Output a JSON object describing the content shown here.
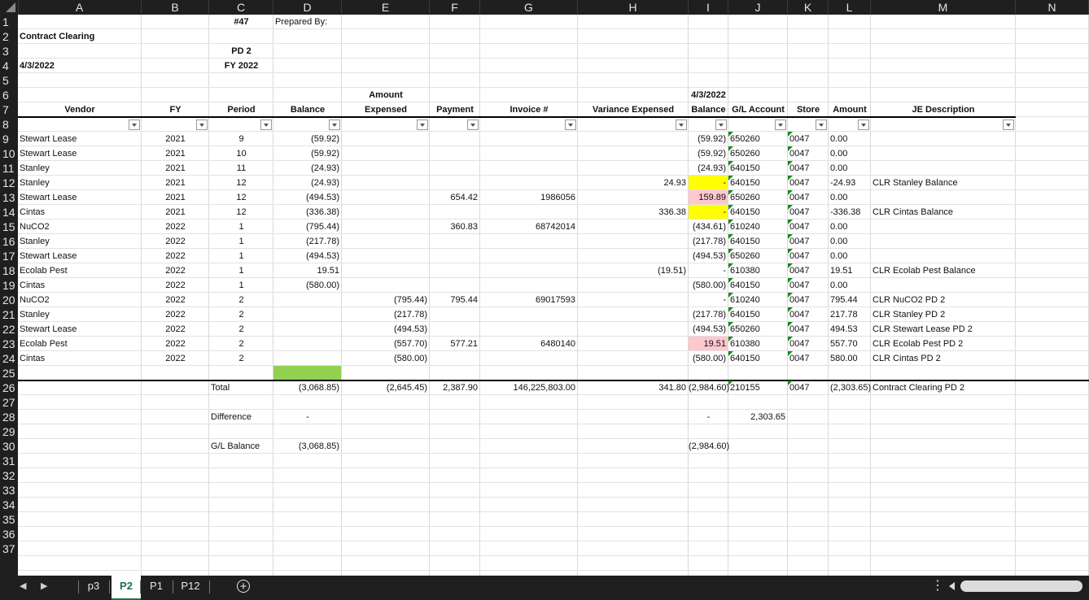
{
  "columns": [
    "A",
    "B",
    "C",
    "D",
    "E",
    "F",
    "G",
    "H",
    "I",
    "J",
    "K",
    "L",
    "M",
    "N"
  ],
  "rows": [
    "1",
    "2",
    "3",
    "4",
    "5",
    "6",
    "7",
    "8",
    "9",
    "10",
    "11",
    "12",
    "13",
    "14",
    "15",
    "16",
    "17",
    "18",
    "19",
    "20",
    "21",
    "22",
    "23",
    "24",
    "25",
    "26",
    "27",
    "28",
    "29",
    "30",
    "31",
    "32",
    "33",
    "34",
    "35",
    "36",
    "37"
  ],
  "header": {
    "sheet_no": "#47",
    "prepared_by": "Prepared By:",
    "title": "Contract Clearing",
    "period": "PD 2",
    "date": "4/3/2022",
    "fiscal_year": "FY 2022",
    "amount_label": "Amount",
    "balance_date": "4/3/2022"
  },
  "col_headers": {
    "vendor": "Vendor",
    "fy": "FY",
    "period": "Period",
    "balance": "Balance",
    "expensed": "Expensed",
    "payment": "Payment",
    "invoice": "Invoice #",
    "variance": "Variance Expensed",
    "balance2": "Balance",
    "gl": "G/L Account",
    "store": "Store",
    "amount": "Amount",
    "je": "JE Description"
  },
  "records": [
    {
      "vendor": "Stewart Lease",
      "fy": "2021",
      "period": "9",
      "balance": "(59.92)",
      "expensed": "",
      "payment": "",
      "invoice": "",
      "variance": "",
      "balance2": "(59.92)",
      "gl": "650260",
      "store": "0047",
      "amount": "0.00",
      "je": ""
    },
    {
      "vendor": "Stewart Lease",
      "fy": "2021",
      "period": "10",
      "balance": "(59.92)",
      "expensed": "",
      "payment": "",
      "invoice": "",
      "variance": "",
      "balance2": "(59.92)",
      "gl": "650260",
      "store": "0047",
      "amount": "0.00",
      "je": ""
    },
    {
      "vendor": "Stanley",
      "fy": "2021",
      "period": "11",
      "balance": "(24.93)",
      "expensed": "",
      "payment": "",
      "invoice": "",
      "variance": "",
      "balance2": "(24.93)",
      "gl": "640150",
      "store": "0047",
      "amount": "0.00",
      "je": ""
    },
    {
      "vendor": "Stanley",
      "fy": "2021",
      "period": "12",
      "balance": "(24.93)",
      "expensed": "",
      "payment": "",
      "invoice": "",
      "variance": "24.93",
      "balance2": "-",
      "gl": "640150",
      "store": "0047",
      "amount": "-24.93",
      "je": "CLR Stanley Balance"
    },
    {
      "vendor": "Stewart Lease",
      "fy": "2021",
      "period": "12",
      "balance": "(494.53)",
      "expensed": "",
      "payment": "654.42",
      "invoice": "1986056",
      "variance": "",
      "balance2": "159.89",
      "gl": "650260",
      "store": "0047",
      "amount": "0.00",
      "je": ""
    },
    {
      "vendor": "Cintas",
      "fy": "2021",
      "period": "12",
      "balance": "(336.38)",
      "expensed": "",
      "payment": "",
      "invoice": "",
      "variance": "336.38",
      "balance2": "-",
      "gl": "640150",
      "store": "0047",
      "amount": "-336.38",
      "je": "CLR Cintas Balance"
    },
    {
      "vendor": "NuCO2",
      "fy": "2022",
      "period": "1",
      "balance": "(795.44)",
      "expensed": "",
      "payment": "360.83",
      "invoice": "68742014",
      "variance": "",
      "balance2": "(434.61)",
      "gl": "610240",
      "store": "0047",
      "amount": "0.00",
      "je": ""
    },
    {
      "vendor": "Stanley",
      "fy": "2022",
      "period": "1",
      "balance": "(217.78)",
      "expensed": "",
      "payment": "",
      "invoice": "",
      "variance": "",
      "balance2": "(217.78)",
      "gl": "640150",
      "store": "0047",
      "amount": "0.00",
      "je": ""
    },
    {
      "vendor": "Stewart Lease",
      "fy": "2022",
      "period": "1",
      "balance": "(494.53)",
      "expensed": "",
      "payment": "",
      "invoice": "",
      "variance": "",
      "balance2": "(494.53)",
      "gl": "650260",
      "store": "0047",
      "amount": "0.00",
      "je": ""
    },
    {
      "vendor": "Ecolab Pest",
      "fy": "2022",
      "period": "1",
      "balance": "19.51",
      "expensed": "",
      "payment": "",
      "invoice": "",
      "variance": "(19.51)",
      "balance2": "-",
      "gl": "610380",
      "store": "0047",
      "amount": "19.51",
      "je": "CLR Ecolab Pest Balance"
    },
    {
      "vendor": "Cintas",
      "fy": "2022",
      "period": "1",
      "balance": "(580.00)",
      "expensed": "",
      "payment": "",
      "invoice": "",
      "variance": "",
      "balance2": "(580.00)",
      "gl": "640150",
      "store": "0047",
      "amount": "0.00",
      "je": ""
    },
    {
      "vendor": "NuCO2",
      "fy": "2022",
      "period": "2",
      "balance": "",
      "expensed": "(795.44)",
      "payment": "795.44",
      "invoice": "69017593",
      "variance": "",
      "balance2": "-",
      "gl": "610240",
      "store": "0047",
      "amount": "795.44",
      "je": "CLR NuCO2 PD 2"
    },
    {
      "vendor": "Stanley",
      "fy": "2022",
      "period": "2",
      "balance": "",
      "expensed": "(217.78)",
      "payment": "",
      "invoice": "",
      "variance": "",
      "balance2": "(217.78)",
      "gl": "640150",
      "store": "0047",
      "amount": "217.78",
      "je": "CLR Stanley PD 2"
    },
    {
      "vendor": "Stewart Lease",
      "fy": "2022",
      "period": "2",
      "balance": "",
      "expensed": "(494.53)",
      "payment": "",
      "invoice": "",
      "variance": "",
      "balance2": "(494.53)",
      "gl": "650260",
      "store": "0047",
      "amount": "494.53",
      "je": "CLR Stewart Lease PD 2"
    },
    {
      "vendor": "Ecolab Pest",
      "fy": "2022",
      "period": "2",
      "balance": "",
      "expensed": "(557.70)",
      "payment": "577.21",
      "invoice": "6480140",
      "variance": "",
      "balance2": "19.51",
      "gl": "610380",
      "store": "0047",
      "amount": "557.70",
      "je": "CLR Ecolab Pest PD 2"
    },
    {
      "vendor": "Cintas",
      "fy": "2022",
      "period": "2",
      "balance": "",
      "expensed": "(580.00)",
      "payment": "",
      "invoice": "",
      "variance": "",
      "balance2": "(580.00)",
      "gl": "640150",
      "store": "0047",
      "amount": "580.00",
      "je": "CLR Cintas PD 2"
    }
  ],
  "fills": {
    "yellow": "#ffff00",
    "pink": "#ffc7ce",
    "green": "#92d050"
  },
  "totals": {
    "label": "Total",
    "balance": "(3,068.85)",
    "expensed": "(2,645.45)",
    "payment": "2,387.90",
    "invoice": "146,225,803.00",
    "variance": "341.80",
    "balance2": "(2,984.60)",
    "gl": "210155",
    "store": "0047",
    "amount": "(2,303.65)",
    "je": "Contract Clearing PD 2"
  },
  "difference": {
    "label": "Difference",
    "balance": "-",
    "balance2": "-",
    "gl": "2,303.65"
  },
  "gl_balance": {
    "label": "G/L Balance",
    "balance": "(3,068.85)",
    "balance2": "(2,984.60)"
  },
  "tabs": [
    {
      "label": "p3"
    },
    {
      "label": "P2",
      "active": true
    },
    {
      "label": "P1"
    },
    {
      "label": "P12"
    }
  ],
  "icons": {
    "add_sheet": "plus-circle-icon",
    "prev": "triangle-left-icon",
    "next": "triangle-right-icon",
    "more": "vertical-dots-icon"
  }
}
